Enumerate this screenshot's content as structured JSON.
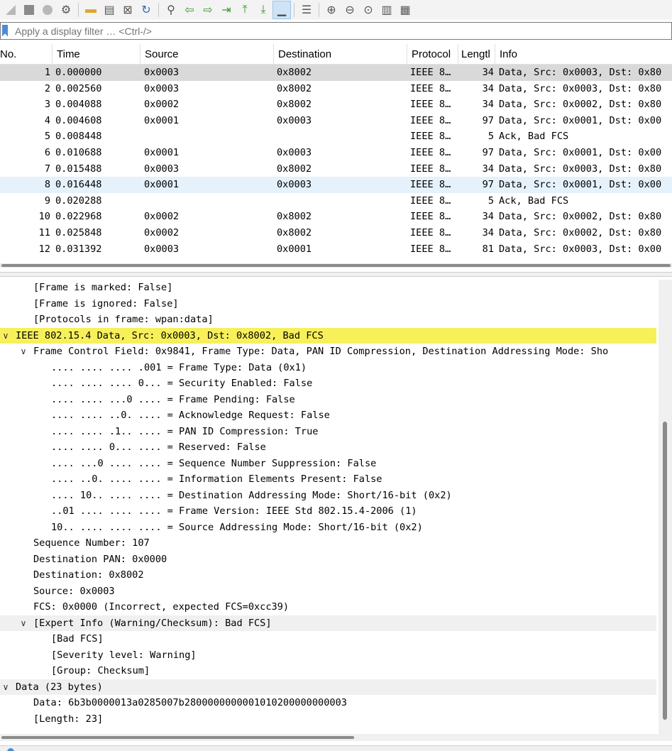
{
  "toolbar": {
    "icons": [
      "shark-fin-start-icon",
      "stop-capture-icon",
      "restart-capture-icon",
      "capture-options-icon",
      "open-file-icon",
      "save-file-icon",
      "close-file-icon",
      "reload-file-icon",
      "find-packet-icon",
      "go-back-icon",
      "go-forward-icon",
      "go-to-packet-icon",
      "go-first-icon",
      "go-last-icon",
      "autoscroll-icon",
      "colorize-icon",
      "zoom-in-icon",
      "zoom-out-icon",
      "zoom-normal-icon",
      "resize-columns-icon",
      "layout-icon"
    ]
  },
  "filter": {
    "placeholder": "Apply a display filter … <Ctrl-/>"
  },
  "packet_list": {
    "columns": {
      "no": "No.",
      "time": "Time",
      "source": "Source",
      "destination": "Destination",
      "protocol": "Protocol",
      "length": "Lengtl",
      "info": "Info"
    },
    "rows": [
      {
        "no": "1",
        "time": "0.000000",
        "src": "0x0003",
        "dst": "0x8002",
        "proto": "IEEE 8…",
        "len": "34",
        "info": "Data, Src: 0x0003, Dst: 0x80"
      },
      {
        "no": "2",
        "time": "0.002560",
        "src": "0x0003",
        "dst": "0x8002",
        "proto": "IEEE 8…",
        "len": "34",
        "info": "Data, Src: 0x0003, Dst: 0x80"
      },
      {
        "no": "3",
        "time": "0.004088",
        "src": "0x0002",
        "dst": "0x8002",
        "proto": "IEEE 8…",
        "len": "34",
        "info": "Data, Src: 0x0002, Dst: 0x80"
      },
      {
        "no": "4",
        "time": "0.004608",
        "src": "0x0001",
        "dst": "0x0003",
        "proto": "IEEE 8…",
        "len": "97",
        "info": "Data, Src: 0x0001, Dst: 0x00"
      },
      {
        "no": "5",
        "time": "0.008448",
        "src": "",
        "dst": "",
        "proto": "IEEE 8…",
        "len": "5",
        "info": "Ack, Bad FCS"
      },
      {
        "no": "6",
        "time": "0.010688",
        "src": "0x0001",
        "dst": "0x0003",
        "proto": "IEEE 8…",
        "len": "97",
        "info": "Data, Src: 0x0001, Dst: 0x00"
      },
      {
        "no": "7",
        "time": "0.015488",
        "src": "0x0003",
        "dst": "0x8002",
        "proto": "IEEE 8…",
        "len": "34",
        "info": "Data, Src: 0x0003, Dst: 0x80"
      },
      {
        "no": "8",
        "time": "0.016448",
        "src": "0x0001",
        "dst": "0x0003",
        "proto": "IEEE 8…",
        "len": "97",
        "info": "Data, Src: 0x0001, Dst: 0x00"
      },
      {
        "no": "9",
        "time": "0.020288",
        "src": "",
        "dst": "",
        "proto": "IEEE 8…",
        "len": "5",
        "info": "Ack, Bad FCS"
      },
      {
        "no": "10",
        "time": "0.022968",
        "src": "0x0002",
        "dst": "0x8002",
        "proto": "IEEE 8…",
        "len": "34",
        "info": "Data, Src: 0x0002, Dst: 0x80"
      },
      {
        "no": "11",
        "time": "0.025848",
        "src": "0x0002",
        "dst": "0x8002",
        "proto": "IEEE 8…",
        "len": "34",
        "info": "Data, Src: 0x0002, Dst: 0x80"
      },
      {
        "no": "12",
        "time": "0.031392",
        "src": "0x0003",
        "dst": "0x0001",
        "proto": "IEEE 8…",
        "len": "81",
        "info": "Data, Src: 0x0003, Dst: 0x00"
      }
    ]
  },
  "details": {
    "lines": [
      {
        "depth": 1,
        "toggle": "",
        "text": "[Frame is marked: False]",
        "style": ""
      },
      {
        "depth": 1,
        "toggle": "",
        "text": "[Frame is ignored: False]",
        "style": ""
      },
      {
        "depth": 1,
        "toggle": "",
        "text": "[Protocols in frame: wpan:data]",
        "style": ""
      },
      {
        "depth": 0,
        "toggle": "expanded",
        "text": "IEEE 802.15.4 Data, Src: 0x0003, Dst: 0x8002, Bad FCS",
        "style": "hl"
      },
      {
        "depth": 1,
        "toggle": "expanded",
        "text": "Frame Control Field: 0x9841, Frame Type: Data, PAN ID Compression, Destination Addressing Mode: Sho",
        "style": ""
      },
      {
        "depth": 2,
        "toggle": "",
        "text": ".... .... .... .001 = Frame Type: Data (0x1)",
        "style": ""
      },
      {
        "depth": 2,
        "toggle": "",
        "text": ".... .... .... 0... = Security Enabled: False",
        "style": ""
      },
      {
        "depth": 2,
        "toggle": "",
        "text": ".... .... ...0 .... = Frame Pending: False",
        "style": ""
      },
      {
        "depth": 2,
        "toggle": "",
        "text": ".... .... ..0. .... = Acknowledge Request: False",
        "style": ""
      },
      {
        "depth": 2,
        "toggle": "",
        "text": ".... .... .1.. .... = PAN ID Compression: True",
        "style": ""
      },
      {
        "depth": 2,
        "toggle": "",
        "text": ".... .... 0... .... = Reserved: False",
        "style": ""
      },
      {
        "depth": 2,
        "toggle": "",
        "text": ".... ...0 .... .... = Sequence Number Suppression: False",
        "style": ""
      },
      {
        "depth": 2,
        "toggle": "",
        "text": ".... ..0. .... .... = Information Elements Present: False",
        "style": ""
      },
      {
        "depth": 2,
        "toggle": "",
        "text": ".... 10.. .... .... = Destination Addressing Mode: Short/16-bit (0x2)",
        "style": ""
      },
      {
        "depth": 2,
        "toggle": "",
        "text": "..01 .... .... .... = Frame Version: IEEE Std 802.15.4-2006 (1)",
        "style": ""
      },
      {
        "depth": 2,
        "toggle": "",
        "text": "10.. .... .... .... = Source Addressing Mode: Short/16-bit (0x2)",
        "style": ""
      },
      {
        "depth": 1,
        "toggle": "",
        "text": "Sequence Number: 107",
        "style": ""
      },
      {
        "depth": 1,
        "toggle": "",
        "text": "Destination PAN: 0x0000",
        "style": ""
      },
      {
        "depth": 1,
        "toggle": "",
        "text": "Destination: 0x8002",
        "style": ""
      },
      {
        "depth": 1,
        "toggle": "",
        "text": "Source: 0x0003",
        "style": ""
      },
      {
        "depth": 1,
        "toggle": "",
        "text": "FCS: 0x0000 (Incorrect, expected FCS=0xcc39)",
        "style": ""
      },
      {
        "depth": 1,
        "toggle": "expanded",
        "text": "[Expert Info (Warning/Checksum): Bad FCS]",
        "style": "grp"
      },
      {
        "depth": 2,
        "toggle": "",
        "text": "[Bad FCS]",
        "style": ""
      },
      {
        "depth": 2,
        "toggle": "",
        "text": "[Severity level: Warning]",
        "style": ""
      },
      {
        "depth": 2,
        "toggle": "",
        "text": "[Group: Checksum]",
        "style": ""
      },
      {
        "depth": 0,
        "toggle": "expanded",
        "text": "Data (23 bytes)",
        "style": "grp"
      },
      {
        "depth": 1,
        "toggle": "",
        "text": "Data: 6b3b0000013a0285007b2800000000001010200000000003",
        "style": ""
      },
      {
        "depth": 1,
        "toggle": "",
        "text": "[Length: 23]",
        "style": ""
      }
    ]
  },
  "colors": {
    "selected_row": "#d9d9d9",
    "hover_row": "#e5f1fb",
    "highlight_line": "#f7f05a"
  }
}
